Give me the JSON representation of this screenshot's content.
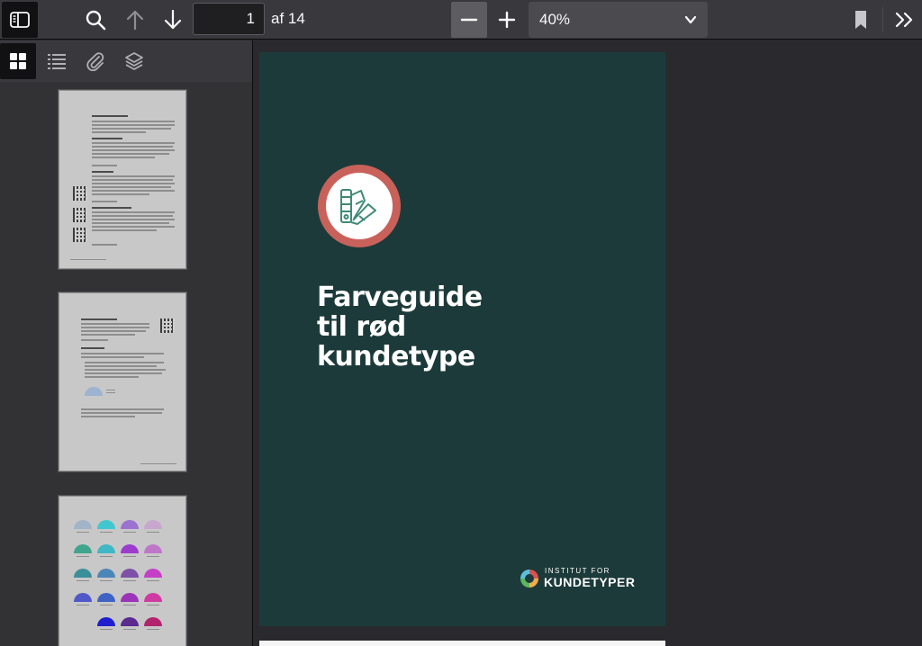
{
  "toolbar": {
    "page_number": "1",
    "page_count_label": "af 14",
    "zoom": "40%",
    "colors": {
      "background": "#38383d",
      "active_button": "#111113",
      "zoom_out_highlight": "#5c5c61"
    }
  },
  "sidebar": {
    "tools": [
      {
        "name": "thumbnails",
        "icon": "grid-icon",
        "active": true
      },
      {
        "name": "outline",
        "icon": "list-icon",
        "active": false
      },
      {
        "name": "attachments",
        "icon": "paperclip-icon",
        "active": false
      },
      {
        "name": "layers",
        "icon": "layers-icon",
        "active": false
      }
    ],
    "thumbnails": [
      {
        "page": 1,
        "content": "text page with QR codes"
      },
      {
        "page": 2,
        "content": "text page with color chart"
      },
      {
        "page": 3,
        "content": "color swatch grid"
      }
    ]
  },
  "document": {
    "title_lines": [
      "Farveguide",
      "til rød",
      "kundetype"
    ],
    "brand_top": "INSTITUT FOR",
    "brand_bottom": "KUNDETYPER",
    "colors": {
      "page_background": "#1d3a3a",
      "emblem_ring": "#c9615b",
      "title": "#ffffff"
    }
  }
}
